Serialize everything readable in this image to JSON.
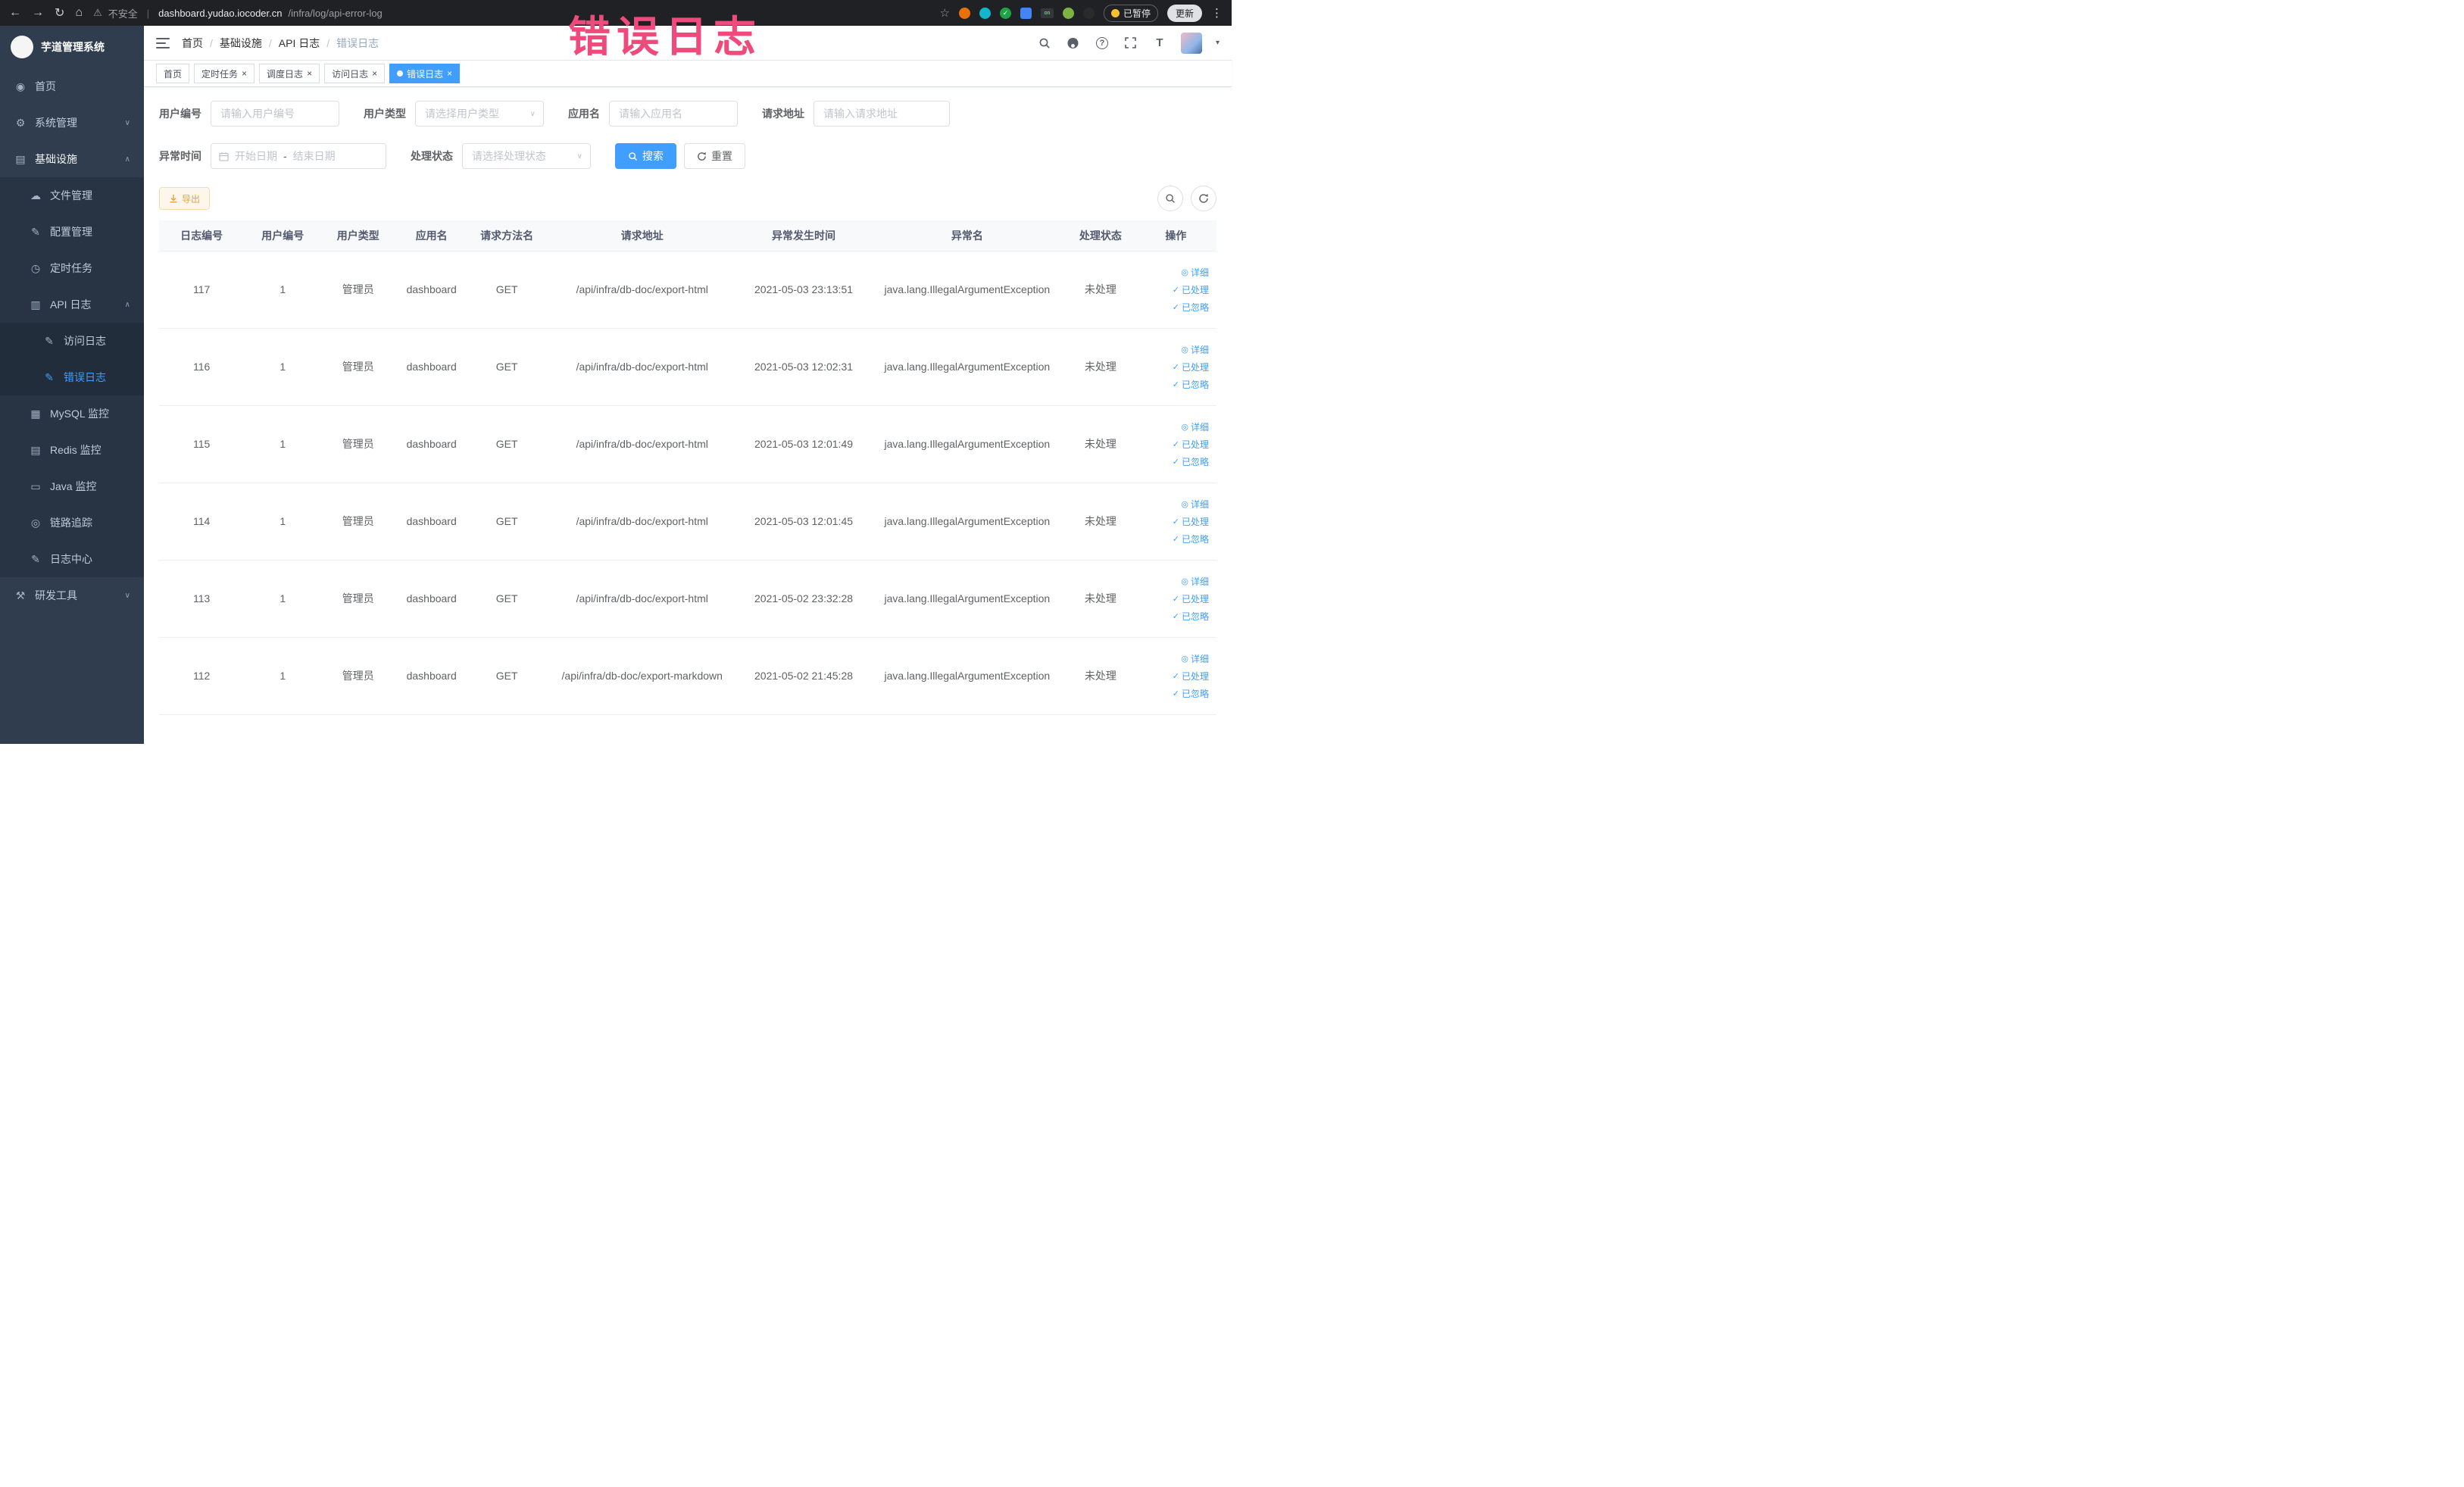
{
  "colors": {
    "accent": "#409eff",
    "annotation": "#ef4a7b",
    "warning": "#e6a23c",
    "sidebar_bg": "#2f3d4f",
    "browser_bar_bg": "#202124",
    "active_tab_bg": "#409eff"
  },
  "annotation": {
    "text": "错误日志"
  },
  "browser": {
    "security_label": "不安全",
    "url_domain": "dashboard.yudao.iocoder.cn",
    "url_path": "/infra/log/api-error-log",
    "paused_badge": "已暂停",
    "update_button": "更新"
  },
  "sidebar": {
    "logo_title": "芋道管理系统",
    "items": [
      {
        "label": "首页"
      },
      {
        "label": "系统管理"
      },
      {
        "label": "基础设施"
      },
      {
        "label": "文件管理"
      },
      {
        "label": "配置管理"
      },
      {
        "label": "定时任务"
      },
      {
        "label": "API 日志"
      },
      {
        "label": "访问日志"
      },
      {
        "label": "错误日志"
      },
      {
        "label": "MySQL 监控"
      },
      {
        "label": "Redis 监控"
      },
      {
        "label": "Java 监控"
      },
      {
        "label": "链路追踪"
      },
      {
        "label": "日志中心"
      },
      {
        "label": "研发工具"
      }
    ]
  },
  "header": {
    "breadcrumb": [
      "首页",
      "基础设施",
      "API 日志",
      "错误日志"
    ]
  },
  "tabs": {
    "close_glyph": "×",
    "items": [
      {
        "label": "首页",
        "classes": [
          "no-close"
        ]
      },
      {
        "label": "定时任务"
      },
      {
        "label": "调度日志"
      },
      {
        "label": "访问日志"
      },
      {
        "label": "错误日志",
        "classes": [
          "active"
        ]
      }
    ]
  },
  "filters": {
    "user_id": {
      "label": "用户编号",
      "placeholder": "请输入用户编号"
    },
    "user_type": {
      "label": "用户类型",
      "placeholder": "请选择用户类型"
    },
    "app_name": {
      "label": "应用名",
      "placeholder": "请输入应用名"
    },
    "request_url": {
      "label": "请求地址",
      "placeholder": "请输入请求地址"
    },
    "exception_time": {
      "label": "异常时间",
      "start_placeholder": "开始日期",
      "separator": "-",
      "end_placeholder": "结束日期"
    },
    "process_status": {
      "label": "处理状态",
      "placeholder": "请选择处理状态"
    },
    "search_button": "搜索",
    "reset_button": "重置"
  },
  "toolbar": {
    "export_button": "导出"
  },
  "table": {
    "columns": [
      "日志编号",
      "用户编号",
      "用户类型",
      "应用名",
      "请求方法名",
      "请求地址",
      "异常发生时间",
      "异常名",
      "处理状态",
      "操作"
    ],
    "action_labels": {
      "detail": "详细",
      "processed": "已处理",
      "ignored": "已忽略"
    },
    "rows": [
      {
        "id": "117",
        "user_id": "1",
        "user_type": "管理员",
        "app": "dashboard",
        "method": "GET",
        "url": "/api/infra/db-doc/export-html",
        "time": "2021-05-03 23:13:51",
        "exception": "java.lang.IllegalArgumentException",
        "status": "未处理"
      },
      {
        "id": "116",
        "user_id": "1",
        "user_type": "管理员",
        "app": "dashboard",
        "method": "GET",
        "url": "/api/infra/db-doc/export-html",
        "time": "2021-05-03 12:02:31",
        "exception": "java.lang.IllegalArgumentException",
        "status": "未处理"
      },
      {
        "id": "115",
        "user_id": "1",
        "user_type": "管理员",
        "app": "dashboard",
        "method": "GET",
        "url": "/api/infra/db-doc/export-html",
        "time": "2021-05-03 12:01:49",
        "exception": "java.lang.IllegalArgumentException",
        "status": "未处理"
      },
      {
        "id": "114",
        "user_id": "1",
        "user_type": "管理员",
        "app": "dashboard",
        "method": "GET",
        "url": "/api/infra/db-doc/export-html",
        "time": "2021-05-03 12:01:45",
        "exception": "java.lang.IllegalArgumentException",
        "status": "未处理"
      },
      {
        "id": "113",
        "user_id": "1",
        "user_type": "管理员",
        "app": "dashboard",
        "method": "GET",
        "url": "/api/infra/db-doc/export-html",
        "time": "2021-05-02 23:32:28",
        "exception": "java.lang.IllegalArgumentException",
        "status": "未处理"
      },
      {
        "id": "112",
        "user_id": "1",
        "user_type": "管理员",
        "app": "dashboard",
        "method": "GET",
        "url": "/api/infra/db-doc/export-markdown",
        "time": "2021-05-02 21:45:28",
        "exception": "java.lang.IllegalArgumentException",
        "status": "未处理"
      }
    ]
  }
}
